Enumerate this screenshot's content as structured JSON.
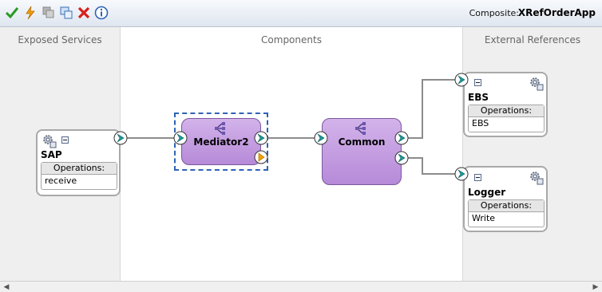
{
  "toolbar": {
    "buttons": [
      {
        "name": "validate-button",
        "icon": "checkmark-icon"
      },
      {
        "name": "lightning-button",
        "icon": "lightning-icon"
      },
      {
        "name": "stack-button",
        "icon": "stack-icon"
      },
      {
        "name": "layout-button",
        "icon": "layout-icon"
      },
      {
        "name": "delete-button",
        "icon": "red-x-icon"
      },
      {
        "name": "info-button",
        "icon": "info-icon"
      }
    ],
    "composite_label": "Composite:",
    "composite_name": "XRefOrderApp"
  },
  "swimlanes": {
    "left": "Exposed Services",
    "middle": "Components",
    "right": "External References"
  },
  "services": [
    {
      "name": "SAP",
      "operations_header": "Operations:",
      "operation": "receive"
    }
  ],
  "components": [
    {
      "name": "Mediator2",
      "selected": true
    },
    {
      "name": "Common",
      "selected": false
    }
  ],
  "references": [
    {
      "name": "EBS",
      "operations_header": "Operations:",
      "operation": "EBS"
    },
    {
      "name": "Logger",
      "operations_header": "Operations:",
      "operation": "Write"
    }
  ],
  "colors": {
    "component_fill": "#c7a2e4",
    "port_teal": "#1a9a9a",
    "selection": "#2e63b5",
    "swimlane_gray": "#efefef"
  }
}
